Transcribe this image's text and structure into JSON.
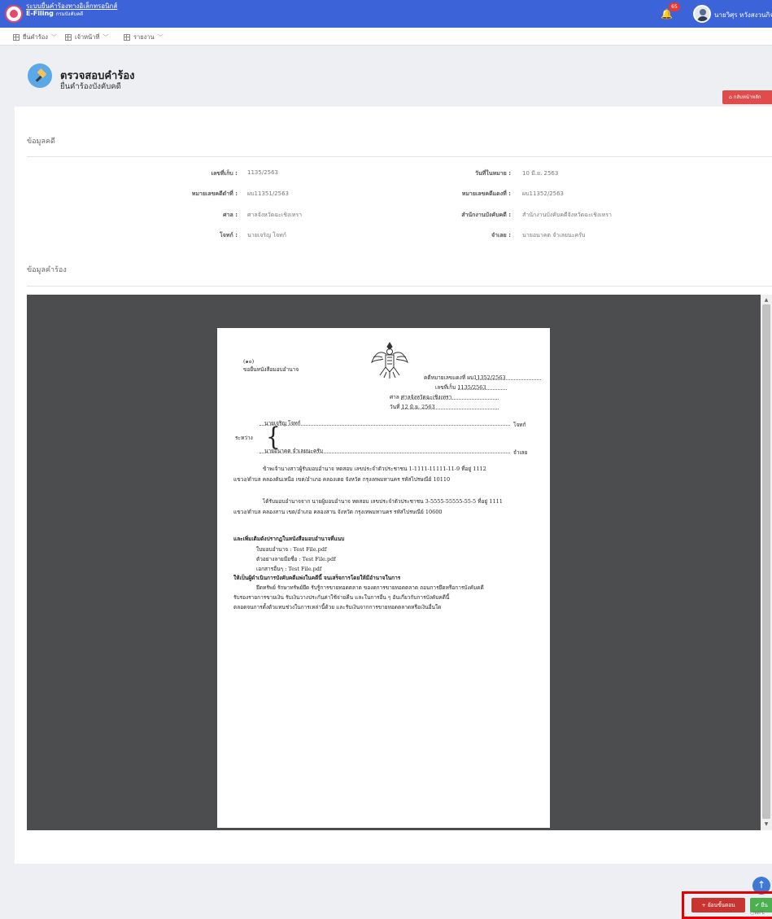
{
  "header": {
    "brand_line1": "ระบบยื่นคำร้องทางอิเล็กทรอนิกส์",
    "brand_line2": "E-Filing",
    "brand_line2_sub": "กรมบังคับคดี",
    "notification_count": "65",
    "username": "นายวิศุร หวังสงวนกิจ"
  },
  "menu": {
    "items": [
      {
        "label": "ยื่นคำร้อง"
      },
      {
        "label": "เจ้าหน้าที่"
      },
      {
        "label": "รายงาน"
      }
    ]
  },
  "page": {
    "title": "ตรวจสอบคำร้อง",
    "subtitle": "ยื่นคำร้องบังคับคดี",
    "back_button": "กลับหน้าหลัก"
  },
  "case_info": {
    "section_title": "ข้อมูลคดี",
    "fields_left": [
      {
        "label": "เลขที่เก็บ :",
        "value": "1135/2563"
      },
      {
        "label": "หมายเลขคดีดำที่ :",
        "value": "ผบ11351/2563"
      },
      {
        "label": "ศาล :",
        "value": "ศาลจังหวัดฉะเชิงเทรา"
      },
      {
        "label": "โจทก์ :",
        "value": "นายเจริญ โจทก์"
      }
    ],
    "fields_right": [
      {
        "label": "วันที่ในหมาย :",
        "value": "10 มี.ย. 2563"
      },
      {
        "label": "หมายเลขคดีแดงที่ :",
        "value": "ผบ11352/2563"
      },
      {
        "label": "สำนักงานบังคับคดี :",
        "value": "สำนักงานบังคับคดีจังหวัดฉะเชิงเทรา"
      },
      {
        "label": "จำเลย :",
        "value": "นายอนาคต จำเลยนะครับ"
      }
    ]
  },
  "petition": {
    "section_title": "ข้อมูลคำร้อง"
  },
  "document": {
    "form_no": "(๑๐)",
    "form_title": "ขอยื่นหนังสือมอบอำนาจ",
    "red_case_label": "คดีหมายเลขแดงที่",
    "red_case_value": "ผบ11352/2563",
    "store_label": "เลขที่เก็บ",
    "store_value": "1135/2563",
    "court_label": "ศาล",
    "court_value": "ศาลจังหวัดฉะเชิงเทรา",
    "date_label": "วันที่",
    "date_value": "12 มิ.ย. 2563",
    "between_label": "ระหว่าง",
    "plaintiff_name": "นายเจริญ โจทก์",
    "plaintiff_role": "โจทก์",
    "defendant_name": "นายอนาคต จำเลยนะครับ",
    "defendant_role": "จำเลย",
    "para1_line1": "ข้าพเจ้านางสาวผู้รับมอบอำนาจ ทดสอบ เลขประจำตัวประชาชน 1-1111-11111-11-9 ที่อยู่ 1112",
    "para1_line2": "แขวง/ตำบล คลองตันเหนือ เขต/อำเภอ คลองเตย จังหวัด กรุงเทพมหานคร รหัสไปรษณีย์ 10110",
    "para2_line1": "ได้รับมอบอำนาจจาก นายผู้มอบอำนาจ ทดสอบ เลขประจำตัวประชาชน 3-5555-55555-55-5 ที่อยู่ 1111",
    "para2_line2": "แขวง/ตำบล คลองสาน เขต/อำเภอ คลองสาน จังหวัด กรุงเทพมหานคร รหัสไปรษณีย์ 10600",
    "attach_heading": "และเพิ่มเติมดังปรากฏในหนังสือมอบอำนาจที่แนบ",
    "attach1": "ใบมอบอำนาจ : Test File.pdf",
    "attach2": "ตัวอย่างลายมือชื่อ : Test File.pdf",
    "attach3": "เอกสารอื่นๆ : Test File.pdf",
    "action_heading": "ให้เป็นผู้ดำเนินการบังคับคดีแพ่งในคดีนี้ จนเสร็จการโดยให้มีอำนาจในการ",
    "action_line1": "ยึดทรัพย์ รักษาทรัพย์ยึด รับรู้การขายทอดตลาด ของดการขายทอดตลาด ถอนการยึดหรือการบังคับคดี",
    "action_line2": "รับรองรายการขายเงิน รับเงินวางประกันค่าใช้จ่ายคืน และในการอื่น ๆ อันเกี่ยวกับการบังคับคดีนี้",
    "action_line3": "ตลอดจนการตั้งตัวแทนช่วงในการเหล่านี้ด้วย และรับเงินจากการขายทอดตลาดหรือเงินอื่นใด"
  },
  "actions": {
    "cancel_label": "ย้อนขั้นตอน",
    "confirm_label": "ยืน",
    "footer_tag": "WPE"
  }
}
